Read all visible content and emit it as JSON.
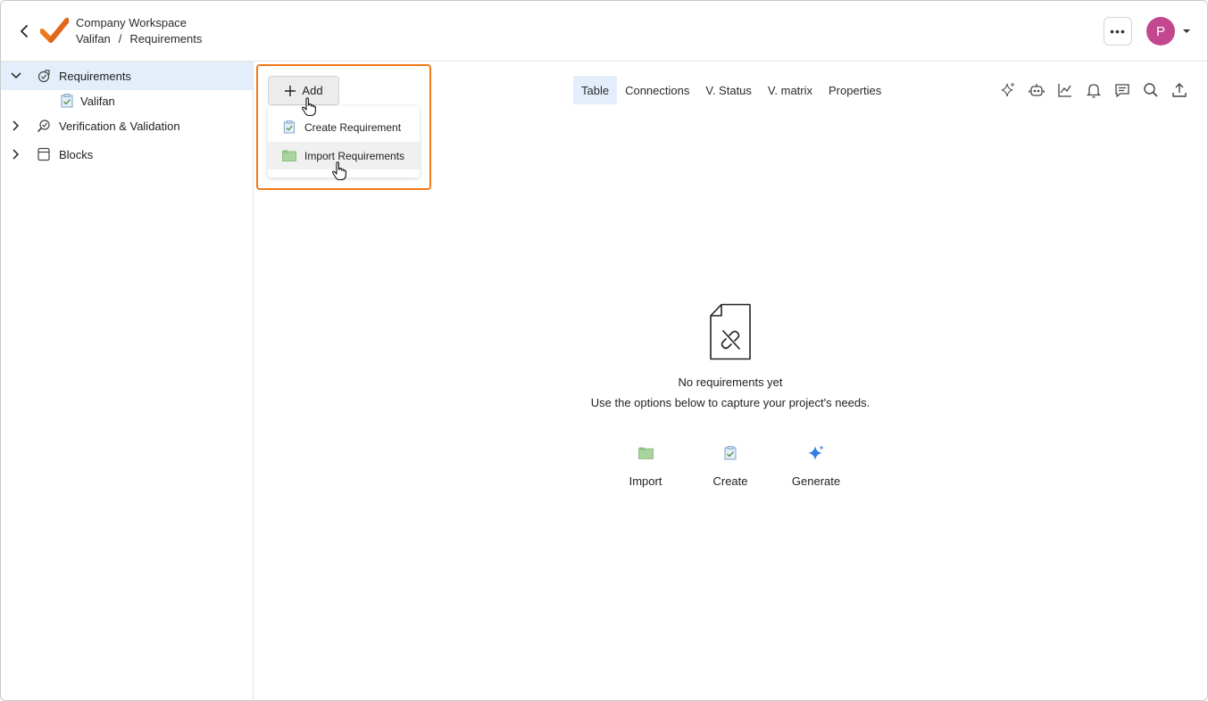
{
  "header": {
    "workspace_name": "Company Workspace",
    "breadcrumb": {
      "project": "Valifan",
      "separator": "/",
      "page": "Requirements"
    },
    "more_label": "•••",
    "avatar_initial": "P",
    "avatar_color": "#c2478e",
    "logo_color": "#f07a1a"
  },
  "sidebar": {
    "items": [
      {
        "label": "Requirements",
        "icon": "requirements-icon",
        "expanded": true,
        "selected": true
      },
      {
        "label": "Valifan",
        "icon": "requirement-doc-icon",
        "child": true
      },
      {
        "label": "Verification & Validation",
        "icon": "verification-icon",
        "expanded": false
      },
      {
        "label": "Blocks",
        "icon": "block-icon",
        "expanded": false
      }
    ]
  },
  "toolbar": {
    "add_label": "Add",
    "tabs": [
      {
        "label": "Table",
        "active": true
      },
      {
        "label": "Connections"
      },
      {
        "label": "V. Status"
      },
      {
        "label": "V. matrix"
      },
      {
        "label": "Properties"
      }
    ],
    "tools": [
      "sparkle-icon",
      "robot-icon",
      "chart-icon",
      "bell-icon",
      "comment-icon",
      "search-icon",
      "upload-icon"
    ]
  },
  "add_menu": {
    "items": [
      {
        "label": "Create Requirement",
        "icon": "requirement-doc-icon"
      },
      {
        "label": "Import Requirements",
        "icon": "import-icon",
        "hovered": true
      }
    ]
  },
  "empty_state": {
    "title": "No requirements yet",
    "subtitle": "Use the options below to capture your project's needs.",
    "actions": [
      {
        "label": "Import",
        "icon": "import-icon"
      },
      {
        "label": "Create",
        "icon": "requirement-doc-icon"
      },
      {
        "label": "Generate",
        "icon": "sparkle-icon"
      }
    ]
  },
  "colors": {
    "accent": "#f07a1a",
    "selected_bg": "#e4eefa",
    "generate_blue": "#2d7fe0"
  }
}
